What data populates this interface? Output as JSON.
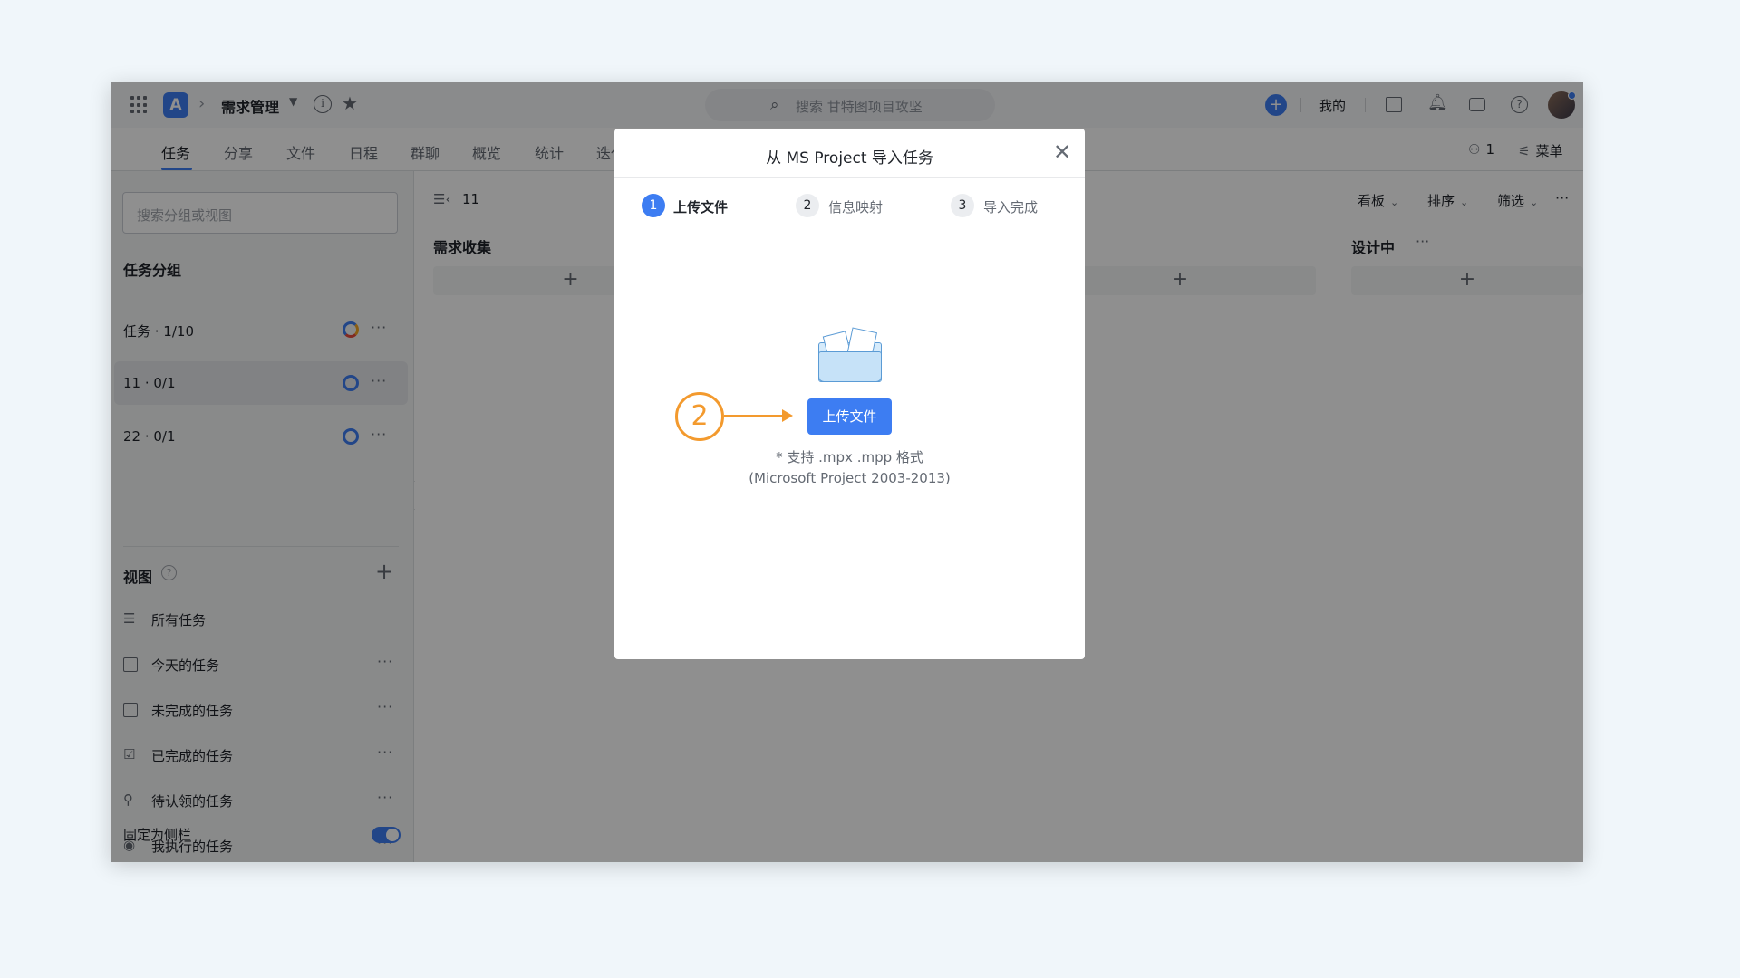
{
  "topbar": {
    "project_name": "需求管理",
    "search_placeholder": "搜索 甘特图项目攻坚",
    "mine_label": "我的"
  },
  "tabs": [
    {
      "label": "任务"
    },
    {
      "label": "分享"
    },
    {
      "label": "文件"
    },
    {
      "label": "日程"
    },
    {
      "label": "群聊"
    },
    {
      "label": "概览"
    },
    {
      "label": "统计"
    },
    {
      "label": "迭代"
    }
  ],
  "tab_right": {
    "member_count": "1",
    "menu_label": "菜单"
  },
  "sidebar": {
    "search_placeholder": "搜索分组或视图",
    "groups_title": "任务分组",
    "groups": [
      {
        "label": "任务 · 1/10"
      },
      {
        "label": "11 · 0/1"
      },
      {
        "label": "22 · 0/1"
      }
    ],
    "views_title": "视图",
    "views": [
      {
        "label": "所有任务",
        "icon": "list-icon"
      },
      {
        "label": "今天的任务",
        "icon": "calendar-icon"
      },
      {
        "label": "未完成的任务",
        "icon": "checkbox-empty-icon"
      },
      {
        "label": "已完成的任务",
        "icon": "checkbox-checked-icon"
      },
      {
        "label": "待认领的任务",
        "icon": "person-icon"
      },
      {
        "label": "我执行的任务",
        "icon": "user-circle-icon"
      }
    ],
    "pin_label": "固定为侧栏"
  },
  "board": {
    "group_name": "11",
    "options": [
      {
        "label": "看板"
      },
      {
        "label": "排序"
      },
      {
        "label": "筛选"
      }
    ],
    "columns": [
      {
        "title": "需求收集"
      },
      {
        "title": "设计中"
      }
    ]
  },
  "modal": {
    "title": "从 MS Project 导入任务",
    "steps": [
      {
        "num": "1",
        "label": "上传文件"
      },
      {
        "num": "2",
        "label": "信息映射"
      },
      {
        "num": "3",
        "label": "导入完成"
      }
    ],
    "upload_button": "上传文件",
    "format_line1": "* 支持 .mpx .mpp 格式",
    "format_line2": "(Microsoft Project 2003-2013)"
  },
  "annotation": {
    "number": "2"
  },
  "colors": {
    "accent": "#3d7df2",
    "annotation": "#f39a2e",
    "page_bg": "#f0f6fa"
  }
}
